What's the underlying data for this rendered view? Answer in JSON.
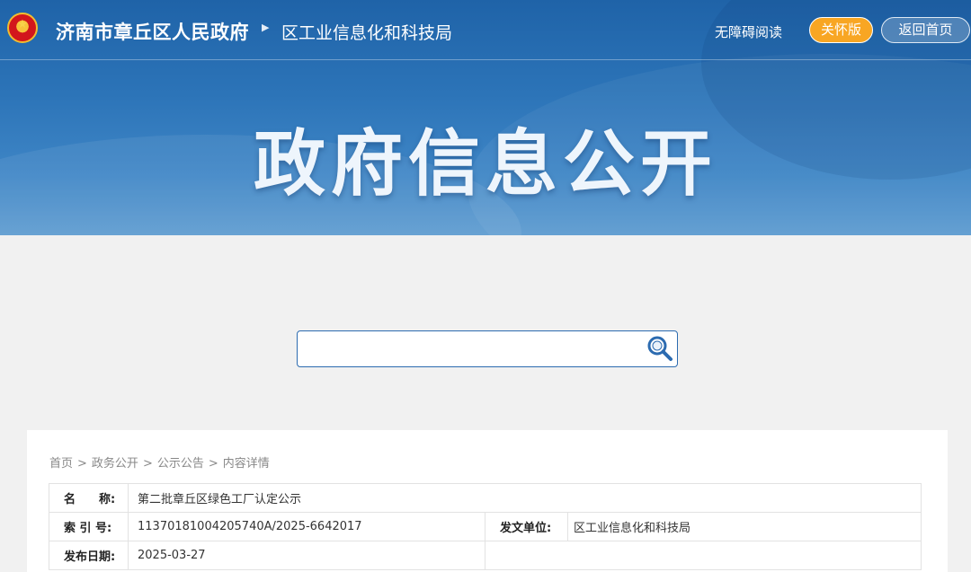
{
  "header": {
    "site_name": "济南市章丘区人民政府",
    "dept_name": "区工业信息化和科技局",
    "accessibility_label": "无障碍阅读",
    "care_mode_label": "关怀版",
    "home_label": "返回首页"
  },
  "hero": {
    "title": "政府信息公开"
  },
  "search": {
    "value": "",
    "placeholder": ""
  },
  "breadcrumb": {
    "items": [
      "首页",
      "政务公开",
      "公示公告",
      "内容详情"
    ],
    "separator": ">"
  },
  "info": {
    "name_label": "名　　称:",
    "name_value": "第二批章丘区绿色工厂认定公示",
    "index_label": "索 引 号:",
    "index_value": "11370181004205740A/2025-6642017",
    "issuer_label": "发文单位:",
    "issuer_value": "区工业信息化和科技局",
    "date_label": "发布日期:",
    "date_value": "2025-03-27"
  },
  "colors": {
    "header_blue": "#1f63a8",
    "care_orange": "#f8a623",
    "search_border": "#2c6bb0"
  },
  "icons": [
    "emblem-icon",
    "arrow-right-icon",
    "search-icon"
  ]
}
